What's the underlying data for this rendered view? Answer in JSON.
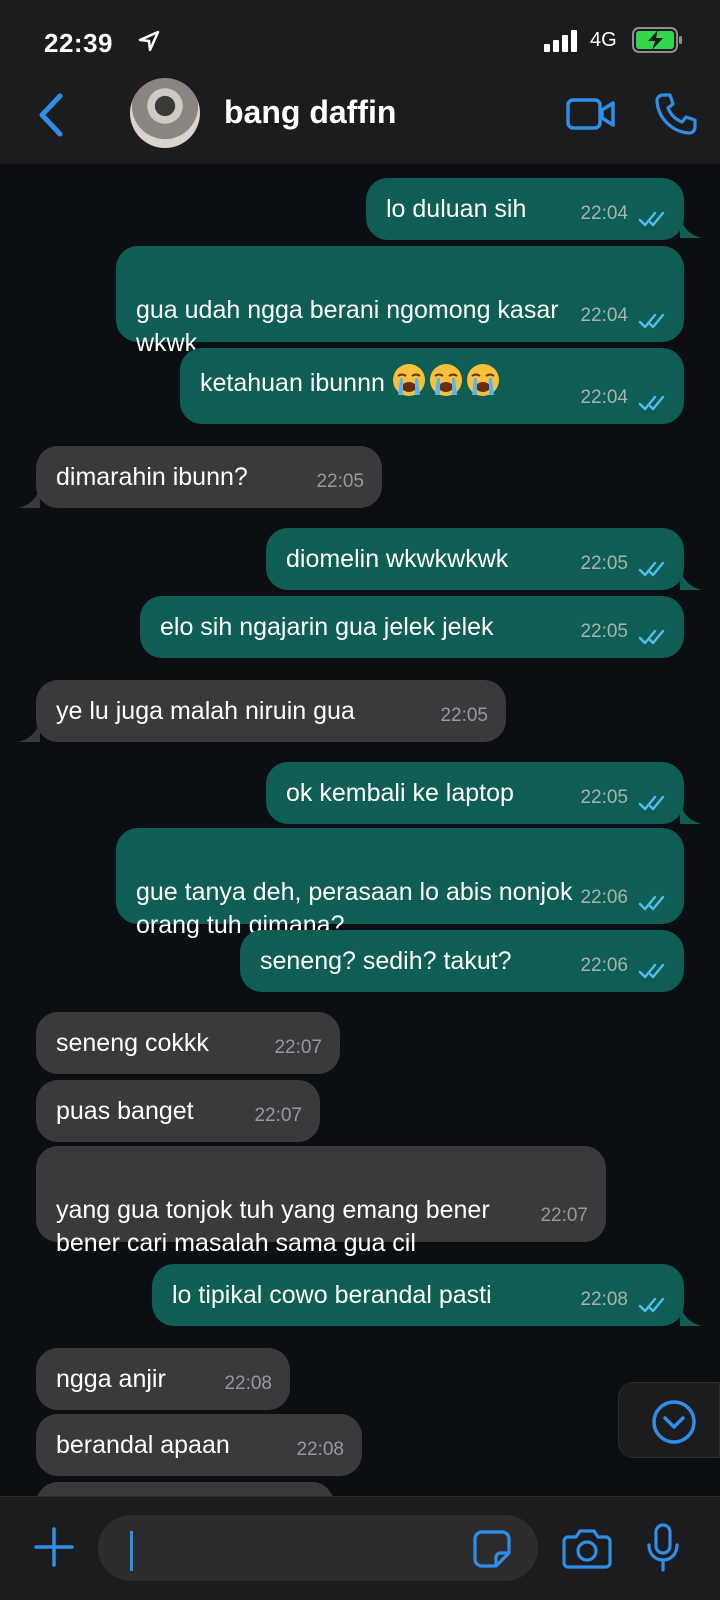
{
  "status_bar": {
    "time": "22:39",
    "network": "4G"
  },
  "header": {
    "contact_name": "bang daffin"
  },
  "messages": [
    {
      "text": "lo duluan sih",
      "time": "22:04"
    },
    {
      "text": "gua udah ngga berani ngomong kasar\nwkwk",
      "time": "22:04"
    },
    {
      "text": "ketahuan ibunnn",
      "emoji": [
        "loudly-crying-face",
        "loudly-crying-face",
        "loudly-crying-face"
      ],
      "time": "22:04"
    },
    {
      "text": "dimarahin ibunn?",
      "time": "22:05"
    },
    {
      "text": "diomelin wkwkwkwk",
      "time": "22:05"
    },
    {
      "text": "elo sih ngajarin gua jelek jelek",
      "time": "22:05"
    },
    {
      "text": "ye lu juga malah niruin gua",
      "time": "22:05"
    },
    {
      "text": "ok kembali ke laptop",
      "time": "22:05"
    },
    {
      "text": "gue tanya deh, perasaan lo abis nonjok\norang tuh gimana?",
      "time": "22:06"
    },
    {
      "text": "seneng? sedih? takut?",
      "time": "22:06"
    },
    {
      "text": "seneng cokkk",
      "time": "22:07"
    },
    {
      "text": "puas banget",
      "time": "22:07"
    },
    {
      "text": "yang gua tonjok tuh yang emang bener\nbener cari masalah sama gua cil",
      "time": "22:07"
    },
    {
      "text": "lo tipikal cowo berandal pasti",
      "time": "22:08"
    },
    {
      "text": "ngga anjir",
      "time": "22:08"
    },
    {
      "text": "berandal apaan",
      "time": "22:08"
    }
  ],
  "colors": {
    "accent": "#2f8fe6",
    "outgoing_bubble": "#0f5e55",
    "incoming_bubble": "#3a3a3c",
    "read_ticks": "#53bdeb",
    "battery_charging": "#32d74b"
  },
  "icons": {
    "back": "chevron-left-icon",
    "video_call": "video-camera-icon",
    "voice_call": "phone-icon",
    "attach": "plus-icon",
    "sticker": "sticker-icon",
    "camera": "camera-icon",
    "mic": "microphone-icon",
    "scroll_down": "chevron-down-circle-icon"
  }
}
